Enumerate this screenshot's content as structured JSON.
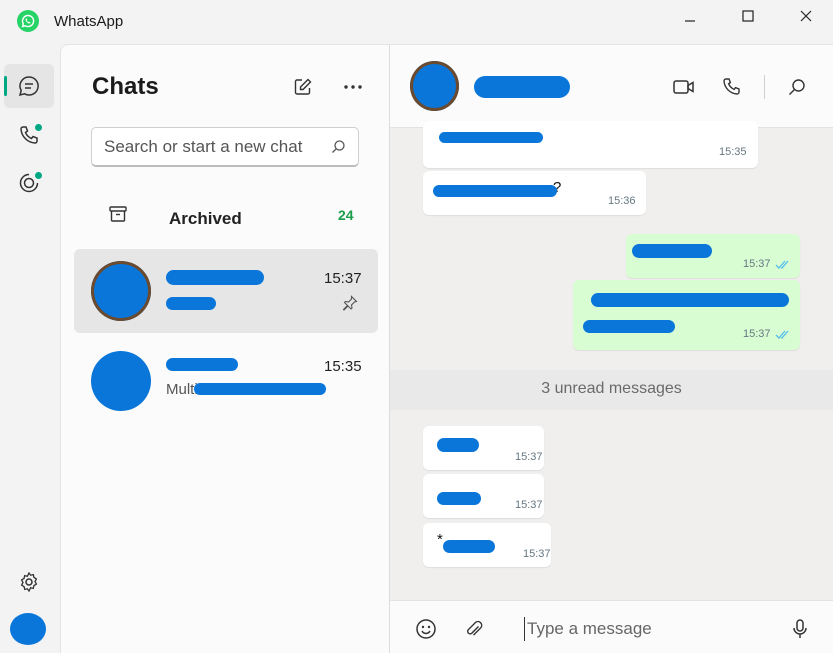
{
  "window": {
    "title": "WhatsApp"
  },
  "rail": {
    "icons": [
      "chats-icon",
      "calls-icon",
      "status-icon",
      "settings-icon",
      "profile-avatar"
    ],
    "accent": "#00a884"
  },
  "chat_list": {
    "title": "Chats",
    "search": {
      "placeholder": "Search or start a new chat",
      "value": ""
    },
    "archived": {
      "label": "Archived",
      "count": "24"
    },
    "chats": [
      {
        "name": "",
        "preview": "",
        "time": "15:37",
        "pinned": true,
        "selected": true
      },
      {
        "name": "",
        "preview": "Multimedia ... Fr..",
        "time": "15:35",
        "pinned": false,
        "selected": false
      }
    ]
  },
  "conversation": {
    "contact_name": "",
    "messages_before": [
      {
        "direction": "in",
        "text": "",
        "time": "15:35"
      },
      {
        "direction": "in",
        "text": "?",
        "time": "15:36"
      },
      {
        "direction": "out",
        "text": "",
        "time": "15:37",
        "status": "read"
      },
      {
        "direction": "out",
        "text": "",
        "time": "15:37",
        "status": "read"
      }
    ],
    "unread_label": "3 unread messages",
    "messages_after": [
      {
        "direction": "in",
        "text": "",
        "time": "15:37"
      },
      {
        "direction": "in",
        "text": "",
        "time": "15:37"
      },
      {
        "direction": "in",
        "text": "*",
        "time": "15:37"
      }
    ],
    "composer": {
      "placeholder": "Type a message",
      "value": ""
    }
  },
  "colors": {
    "accent": "#00a884",
    "outgoing_bubble": "#d9fdd3",
    "incoming_bubble": "#ffffff",
    "redaction": "#0a76d9",
    "archived_count": "#1a9e4c",
    "read_ticks": "#53bdeb"
  }
}
